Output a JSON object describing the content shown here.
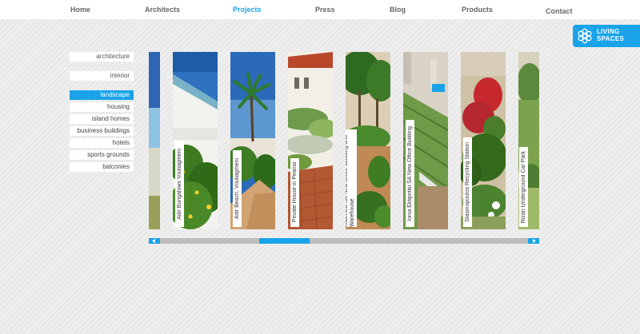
{
  "nav": {
    "items": [
      {
        "label": "Home"
      },
      {
        "label": "Architects"
      },
      {
        "label": "Projects"
      },
      {
        "label": "Press"
      },
      {
        "label": "Blog"
      },
      {
        "label": "Products"
      },
      {
        "label": "Contact"
      }
    ],
    "active": "Projects"
  },
  "logo": {
    "line1": "LIVING",
    "line2": "SPACES",
    "icon": "flower-logo-icon"
  },
  "categories": {
    "primary": [
      "architecture",
      "interior"
    ],
    "sub": [
      "landscape",
      "housing",
      "island homes",
      "business buildings",
      "hotels",
      "sports grounds",
      "balconies"
    ],
    "active": "landscape"
  },
  "projects": [
    {
      "title": "Adir Bungalows Vouliagmeni"
    },
    {
      "title": "Adir Beach, Vouliagmeni"
    },
    {
      "title": "Private House in Peania"
    },
    {
      "title": "Galenica SA New Office Building and Warehouse"
    },
    {
      "title": "Ionia Ektipotiki SA New Office Building"
    },
    {
      "title": "Stasinopoulos Recycling Station"
    },
    {
      "title": "Rizari Underground Car Park"
    }
  ],
  "scroll": {
    "left_icon": "arrow-left-icon",
    "right_icon": "arrow-right-icon"
  },
  "colors": {
    "accent": "#1aa3e8",
    "nav_text": "#666666"
  }
}
